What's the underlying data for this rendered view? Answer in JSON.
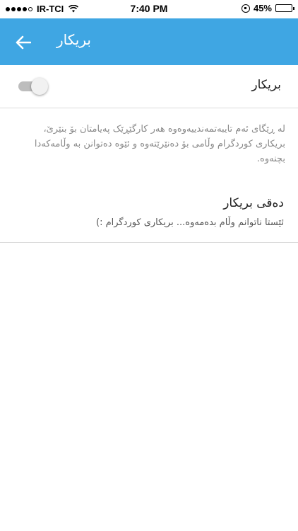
{
  "status_bar": {
    "carrier": "IR-TCI",
    "time": "7:40 PM",
    "battery": "45%",
    "battery_level": 0.45,
    "icons": [
      "signal-icon",
      "wifi-icon",
      "rotation-lock-icon",
      "battery-icon"
    ]
  },
  "app_bar": {
    "title": "بریکار",
    "back_icon": "back-arrow-icon",
    "color": "#3fa6e3"
  },
  "toggle_row": {
    "label": "بریکار",
    "enabled": false
  },
  "description": "لە ڕێگای ئەم تایبەتمەندییەوەوە هەر کارگێڕێک پەیامتان بۆ بنێرێ، بریکاری کوردگرام وڵامی بۆ دەنێرێتەوە و ئێوە دەتوانن بە وڵامەکەدا بچنەوە.",
  "message_row": {
    "title": "دەقی بریکار",
    "body": "ئێستا ناتوانم وڵام بدەمەوە... بریکاری کوردگرام :)"
  }
}
